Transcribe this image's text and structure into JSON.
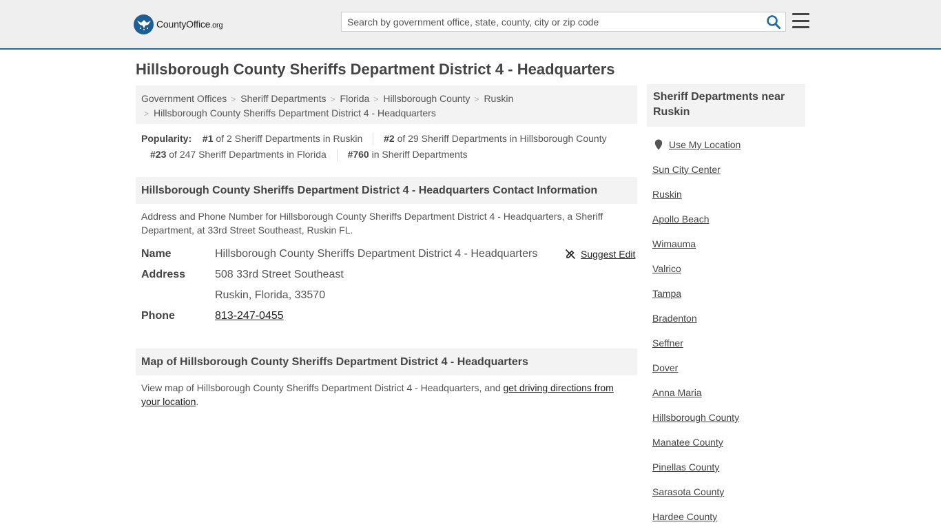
{
  "header": {
    "logo_text_main": "CountyOffice",
    "logo_text_tld": ".org",
    "search_placeholder": "Search by government office, state, county, city or zip code"
  },
  "page_title": "Hillsborough County Sheriffs Department District 4 - Headquarters",
  "breadcrumb": [
    "Government Offices",
    "Sheriff Departments",
    "Florida",
    "Hillsborough County",
    "Ruskin",
    "Hillsborough County Sheriffs Department District 4 - Headquarters"
  ],
  "popularity": {
    "label": "Popularity:",
    "items": [
      {
        "rank": "#1",
        "text": " of 2 Sheriff Departments in Ruskin"
      },
      {
        "rank": "#2",
        "text": " of 29 Sheriff Departments in Hillsborough County"
      },
      {
        "rank": "#23",
        "text": " of 247 Sheriff Departments in Florida"
      },
      {
        "rank": "#760",
        "text": " in Sheriff Departments"
      }
    ]
  },
  "contact": {
    "heading": "Hillsborough County Sheriffs Department District 4 - Headquarters Contact Information",
    "description": "Address and Phone Number for Hillsborough County Sheriffs Department District 4 - Headquarters, a Sheriff Department, at 33rd Street Southeast, Ruskin FL.",
    "name_label": "Name",
    "name_value": "Hillsborough County Sheriffs Department District 4 - Headquarters",
    "suggest_edit": "Suggest Edit",
    "address_label": "Address",
    "address_line1": "508 33rd Street Southeast",
    "address_line2": "Ruskin, Florida, 33570",
    "phone_label": "Phone",
    "phone_value": "813-247-0455"
  },
  "map": {
    "heading": "Map of Hillsborough County Sheriffs Department District 4 - Headquarters",
    "description_prefix": "View map of Hillsborough County Sheriffs Department District 4 - Headquarters, and ",
    "directions_link": "get driving directions from your location",
    "description_suffix": "."
  },
  "sidebar": {
    "heading": "Sheriff Departments near Ruskin",
    "use_location": "Use My Location",
    "items": [
      "Sun City Center",
      "Ruskin",
      "Apollo Beach",
      "Wimauma",
      "Valrico",
      "Tampa",
      "Bradenton",
      "Seffner",
      "Dover",
      "Anna Maria",
      "Hillsborough County",
      "Manatee County",
      "Pinellas County",
      "Sarasota County",
      "Hardee County"
    ]
  },
  "colors": {
    "header_bg": "#efefef",
    "accent_blue": "#1d6ca6",
    "panel_bg": "#f3f3f3"
  }
}
